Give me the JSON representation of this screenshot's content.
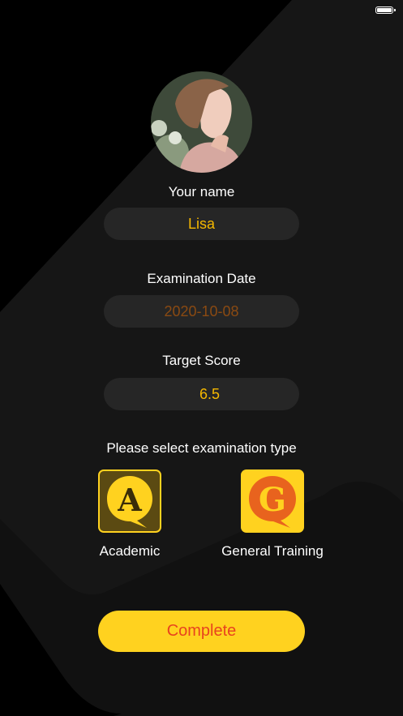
{
  "form": {
    "name_label": "Your name",
    "name_value": "Lisa",
    "date_label": "Examination Date",
    "date_value": "2020-10-08",
    "score_label": "Target Score",
    "score_value": "6.5"
  },
  "exam_type": {
    "prompt": "Please select examination type",
    "options": [
      {
        "label": "Academic",
        "icon": "academic-a-icon",
        "selected": true
      },
      {
        "label": "General Training",
        "icon": "general-g-icon",
        "selected": false
      }
    ]
  },
  "actions": {
    "complete_label": "Complete"
  },
  "colors": {
    "accent_yellow": "#ffd21f",
    "value_yellow": "#f5b800",
    "button_text": "#e8431e",
    "field_bg": "#262626"
  }
}
